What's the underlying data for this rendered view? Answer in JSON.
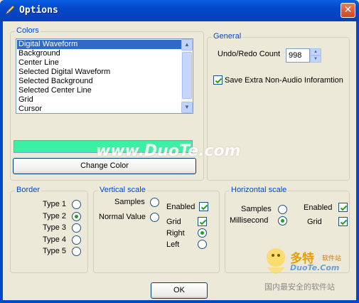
{
  "window": {
    "title": "Options",
    "close_glyph": "✕",
    "icon": "app-pen-icon"
  },
  "colors_group": {
    "title": "Colors",
    "items": [
      {
        "label": "Digital Waveform",
        "selected": true
      },
      {
        "label": "Background",
        "selected": false
      },
      {
        "label": "Center Line",
        "selected": false
      },
      {
        "label": "Selected  Digital Waveform",
        "selected": false
      },
      {
        "label": "Selected Background",
        "selected": false
      },
      {
        "label": "Selected Center Line",
        "selected": false
      },
      {
        "label": "Grid",
        "selected": false
      },
      {
        "label": "Cursor",
        "selected": false
      }
    ],
    "swatch_color": "#3af0a5",
    "change_color_label": "Change Color"
  },
  "general_group": {
    "title": "General",
    "undo_label": "Undo/Redo Count",
    "undo_value": "998",
    "save_extra_label": "Save Extra Non-Audio Inforamtion",
    "save_extra_checked": true
  },
  "border_group": {
    "title": "Border",
    "options": [
      {
        "label": "Type 1",
        "checked": false
      },
      {
        "label": "Type 2",
        "checked": true
      },
      {
        "label": "Type 3",
        "checked": false
      },
      {
        "label": "Type 4",
        "checked": false
      },
      {
        "label": "Type 5",
        "checked": false
      }
    ]
  },
  "vertical_group": {
    "title": "Vertical scale",
    "samples_label": "Samples",
    "normal_label": "Normal Value",
    "enabled_label": "Enabled",
    "grid_label": "Grid",
    "right_label": "Right",
    "left_label": "Left"
  },
  "horizontal_group": {
    "title": "Horizontal scale",
    "samples_label": "Samples",
    "millisecond_label": "Millisecond",
    "enabled_label": "Enabled",
    "grid_label": "Grid"
  },
  "footer": {
    "ok_label": "OK"
  },
  "watermark": {
    "text": "www.DuoTe.com"
  },
  "logo": {
    "cn_title": "多特",
    "cn_sub": "软件站",
    "domain": "DuoTe.Com",
    "slogan": "国内最安全的软件站"
  }
}
